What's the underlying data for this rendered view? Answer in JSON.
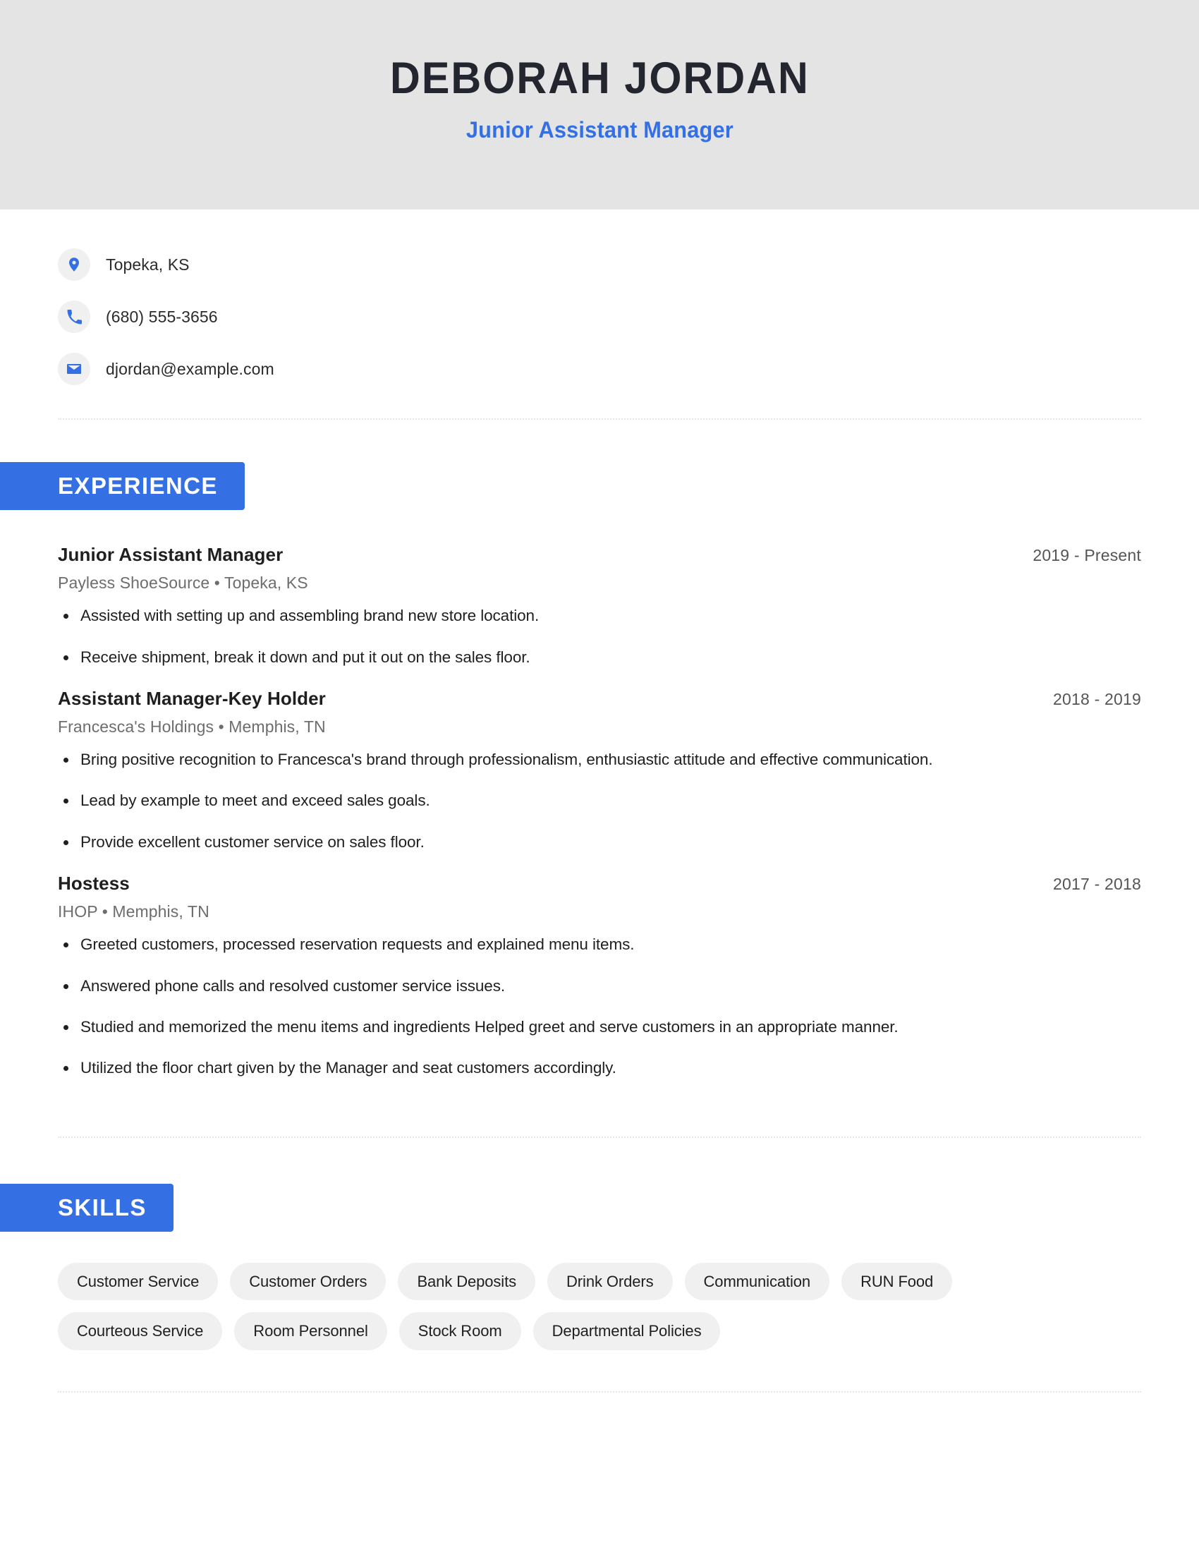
{
  "header": {
    "name": "DEBORAH JORDAN",
    "title": "Junior Assistant Manager",
    "background_color": "#e4e4e4",
    "accent_color": "#3470e4"
  },
  "contact": {
    "items": [
      {
        "icon": "location-pin-icon",
        "value": "Topeka, KS"
      },
      {
        "icon": "phone-icon",
        "value": "(680) 555-3656"
      },
      {
        "icon": "email-envelope-icon",
        "value": "djordan@example.com"
      }
    ]
  },
  "experience": {
    "heading": "EXPERIENCE",
    "entries": [
      {
        "role": "Junior Assistant Manager",
        "dates": "2019 - Present",
        "company": "Payless ShoeSource",
        "separator": "•",
        "location": "Topeka, KS",
        "meta": "Payless ShoeSource  •  Topeka, KS",
        "bullets": [
          "Assisted with setting up and assembling brand new store location.",
          "Receive shipment, break it down and put it out on the sales floor."
        ]
      },
      {
        "role": "Assistant Manager-Key Holder",
        "dates": "2018 - 2019",
        "company": "Francesca's Holdings",
        "separator": "•",
        "location": "Memphis, TN",
        "meta": "Francesca's Holdings  •  Memphis, TN",
        "bullets": [
          "Bring positive recognition to Francesca's brand through professionalism, enthusiastic attitude and effective communication.",
          "Lead by example to meet and exceed sales goals.",
          "Provide excellent customer service on sales floor."
        ]
      },
      {
        "role": "Hostess",
        "dates": "2017 - 2018",
        "company": "IHOP",
        "separator": "•",
        "location": "Memphis, TN",
        "meta": "IHOP  •  Memphis, TN",
        "bullets": [
          "Greeted customers, processed reservation requests and explained menu items.",
          "Answered phone calls and resolved customer service issues.",
          "Studied and memorized the menu items and ingredients Helped greet and serve customers in an appropriate manner.",
          "Utilized the floor chart given by the Manager and seat customers accordingly."
        ]
      }
    ]
  },
  "skills": {
    "heading": "SKILLS",
    "items": [
      "Customer Service",
      "Customer Orders",
      "Bank Deposits",
      "Drink Orders",
      "Communication",
      "RUN Food",
      "Courteous Service",
      "Room Personnel",
      "Stock Room",
      "Departmental Policies"
    ]
  }
}
